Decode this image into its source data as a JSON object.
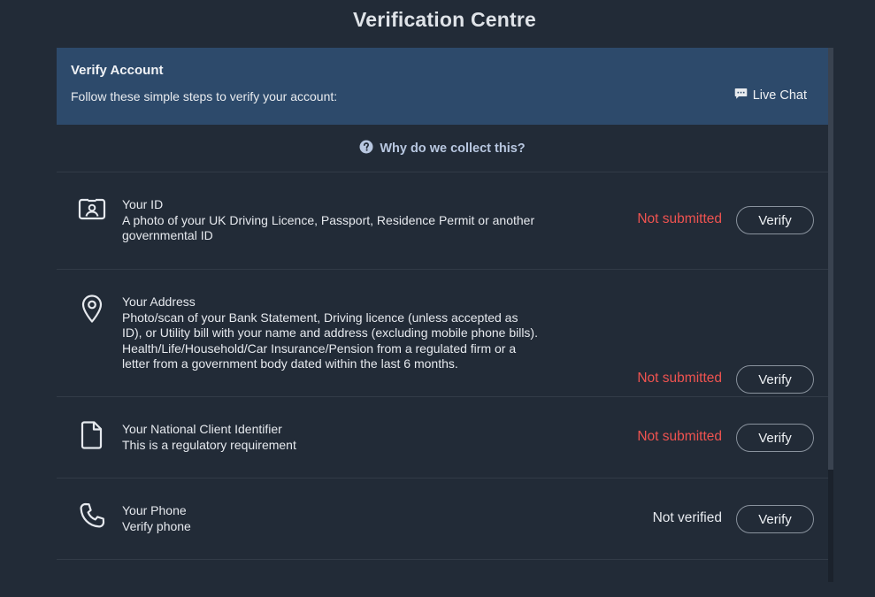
{
  "page": {
    "title": "Verification Centre"
  },
  "header": {
    "title": "Verify Account",
    "subtitle": "Follow these simple steps to verify your account:",
    "live_chat_label": "Live Chat"
  },
  "why": {
    "label": "Why do we collect this?"
  },
  "steps": [
    {
      "icon": "id-card-icon",
      "title": "Your ID",
      "description": "A photo of your UK Driving Licence, Passport, Residence Permit or another governmental ID",
      "status": "Not submitted",
      "button_label": "Verify"
    },
    {
      "icon": "location-pin-icon",
      "title": "Your Address",
      "description": "Photo/scan of your Bank Statement, Driving licence (unless accepted as ID), or Utility bill with your name and address (excluding mobile phone bills). Health/Life/Household/Car Insurance/Pension from a regulated firm or a letter from a government body dated within the last 6 months.",
      "status": "Not submitted",
      "button_label": "Verify"
    },
    {
      "icon": "document-icon",
      "title": "Your National Client Identifier",
      "description": "This is a regulatory requirement",
      "status": "Not submitted",
      "button_label": "Verify"
    },
    {
      "icon": "phone-icon",
      "title": "Your Phone",
      "description": "Verify phone",
      "status": "Not verified",
      "button_label": "Verify"
    }
  ],
  "colors": {
    "background": "#222b37",
    "header_bg": "#2d4a6b",
    "status_not_submitted": "#ef5350",
    "link": "#b8c7e0"
  }
}
